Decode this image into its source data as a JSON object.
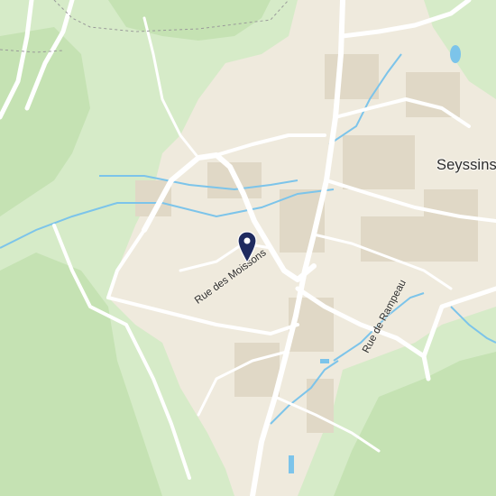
{
  "map": {
    "place_labels": [
      {
        "name": "Seyssins"
      }
    ],
    "street_labels": [
      {
        "name": "Rue des Moissons"
      },
      {
        "name": "Rue de Rampeau"
      }
    ],
    "marker": {
      "type": "location-pin",
      "color": "#1f2b5f"
    },
    "colors": {
      "urban": "#efeadd",
      "vegetation": "#d6ebc8",
      "forest": "#c5e2b3",
      "road": "#ffffff",
      "water": "#7cc4ea",
      "buildings": "#e0d8c6"
    }
  }
}
